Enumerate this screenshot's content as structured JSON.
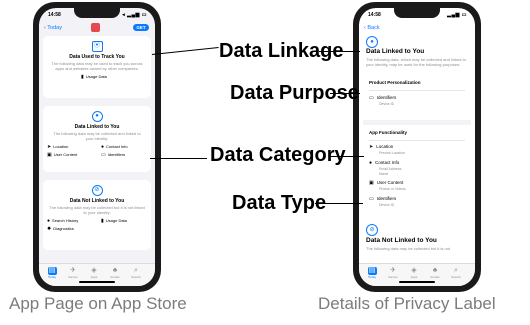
{
  "left_phone": {
    "status_time": "14:58",
    "status_icons": "◂ ▂▄▆ ▭",
    "back_label": "Today",
    "get_label": "GET",
    "card_track": {
      "title": "Data Used to Track You",
      "desc": "The following data may be used to track you across apps and websites owned by other companies:",
      "items": [
        "Usage Data"
      ]
    },
    "card_linked": {
      "title": "Data Linked to You",
      "desc": "The following data may be collected and linked to your identity:",
      "items": [
        "Location",
        "Contact Info",
        "User Content",
        "Identifiers"
      ]
    },
    "card_not_linked": {
      "title": "Data Not Linked to You",
      "desc": "The following data may be collected but it is not linked to your identity:",
      "items": [
        "Search History",
        "Usage Data",
        "Diagnostics"
      ]
    },
    "tabs": [
      "Today",
      "Games",
      "Apps",
      "Arcade",
      "Search"
    ]
  },
  "right_phone": {
    "status_time": "14:58",
    "status_icons": "▂▄▆ ▭",
    "back_label": "Back",
    "linked_title": "Data Linked to You",
    "linked_desc": "The following data, which may be collected and linked to your identity, may be used for the following purposes:",
    "section_product": "Product Personalization",
    "identifiers_label": "Identifiers",
    "device_id": "Device ID",
    "section_app": "App Functionality",
    "location_label": "Location",
    "precise_location": "Precise Location",
    "contact_label": "Contact Info",
    "email_address": "Email Address",
    "name_label": "Name",
    "user_content_label": "User Content",
    "photos_videos": "Photos or Videos",
    "identifiers2_label": "Identifiers",
    "device_id2": "Device ID",
    "not_linked_title": "Data Not Linked to You",
    "not_linked_desc": "The following data may be collected but it is not",
    "tabs": [
      "Today",
      "Games",
      "Apps",
      "Arcade",
      "Search"
    ]
  },
  "annotations": {
    "linkage": "Data Linkage",
    "purpose": "Data Purpose",
    "category": "Data Category",
    "type": "Data Type"
  },
  "captions": {
    "left": "App Page on App Store",
    "right": "Details of Privacy Label"
  }
}
